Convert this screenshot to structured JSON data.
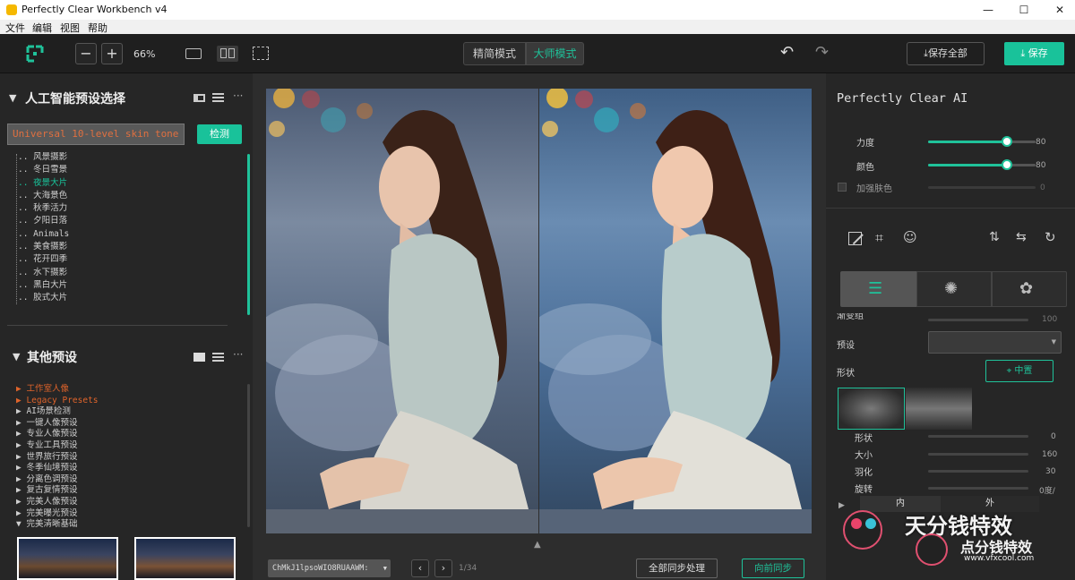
{
  "window": {
    "title": "Perfectly Clear Workbench v4",
    "minimize": "—",
    "maximize": "☐",
    "close": "✕"
  },
  "menu": [
    "文件",
    "编辑",
    "视图",
    "帮助"
  ],
  "toolbar": {
    "zoom_minus": "−",
    "zoom_plus": "+",
    "zoom_level": "66%",
    "mode_simple": "精简模式",
    "mode_master": "大师模式",
    "save_all": "保存全部",
    "save": "保存"
  },
  "left_panel": {
    "ai_header": "人工智能预设选择",
    "preset_input_value": "Universal 10-level skin tone",
    "detect_button": "检测",
    "ai_presets": [
      "风景摄影",
      "冬日雪景",
      "夜景大片",
      "大海景色",
      "秋季活力",
      "夕阳日落",
      "Animals",
      "美食摄影",
      "花开四季",
      "水下摄影",
      "黑白大片",
      "胶式大片"
    ],
    "ai_selected_index": 2,
    "other_header": "其他预设",
    "other_presets": [
      "工作室人像",
      "Legacy Presets",
      "AI场景检测",
      "一键人像预设",
      "专业人像预设",
      "专业工具预设",
      "世界旅行预设",
      "冬季仙境预设",
      "分离色调预设",
      "复古复情预设",
      "完美人像预设",
      "完美曝光预设",
      "完美清晰基础"
    ],
    "other_highlight": [
      0,
      1
    ]
  },
  "bottom_bar": {
    "filename": "ChMkJ1lpsoWIO8RUAAWM:",
    "page_info": "1/34",
    "sync_all": "全部同步处理",
    "sync_forward": "向前同步"
  },
  "right_panel": {
    "title": "Perfectly Clear AI",
    "strength_label": "力度",
    "strength_value": "80",
    "color_label": "颜色",
    "color_value": "80",
    "skin_label": "加强肤色",
    "skin_value": "0",
    "row_partial_label": "渐变组",
    "row_partial_value": "100",
    "preset_label": "预设",
    "shape_label": "形状",
    "center_button": "中置",
    "shape_label2": "形状",
    "shape_value": "0",
    "size_label": "大小",
    "size_value": "160",
    "feather_label": "羽化",
    "feather_value": "30",
    "rotate_label": "旋转",
    "rotate_value": "0度/",
    "tab_in": "内",
    "tab_out": "外",
    "watermark_big": "天分钱特效",
    "watermark_small": "点分钱特效",
    "watermark_url": "www.vfxcool.com"
  },
  "colors": {
    "accent": "#19c29a",
    "bg": "#232323",
    "orange": "#e0642b"
  }
}
